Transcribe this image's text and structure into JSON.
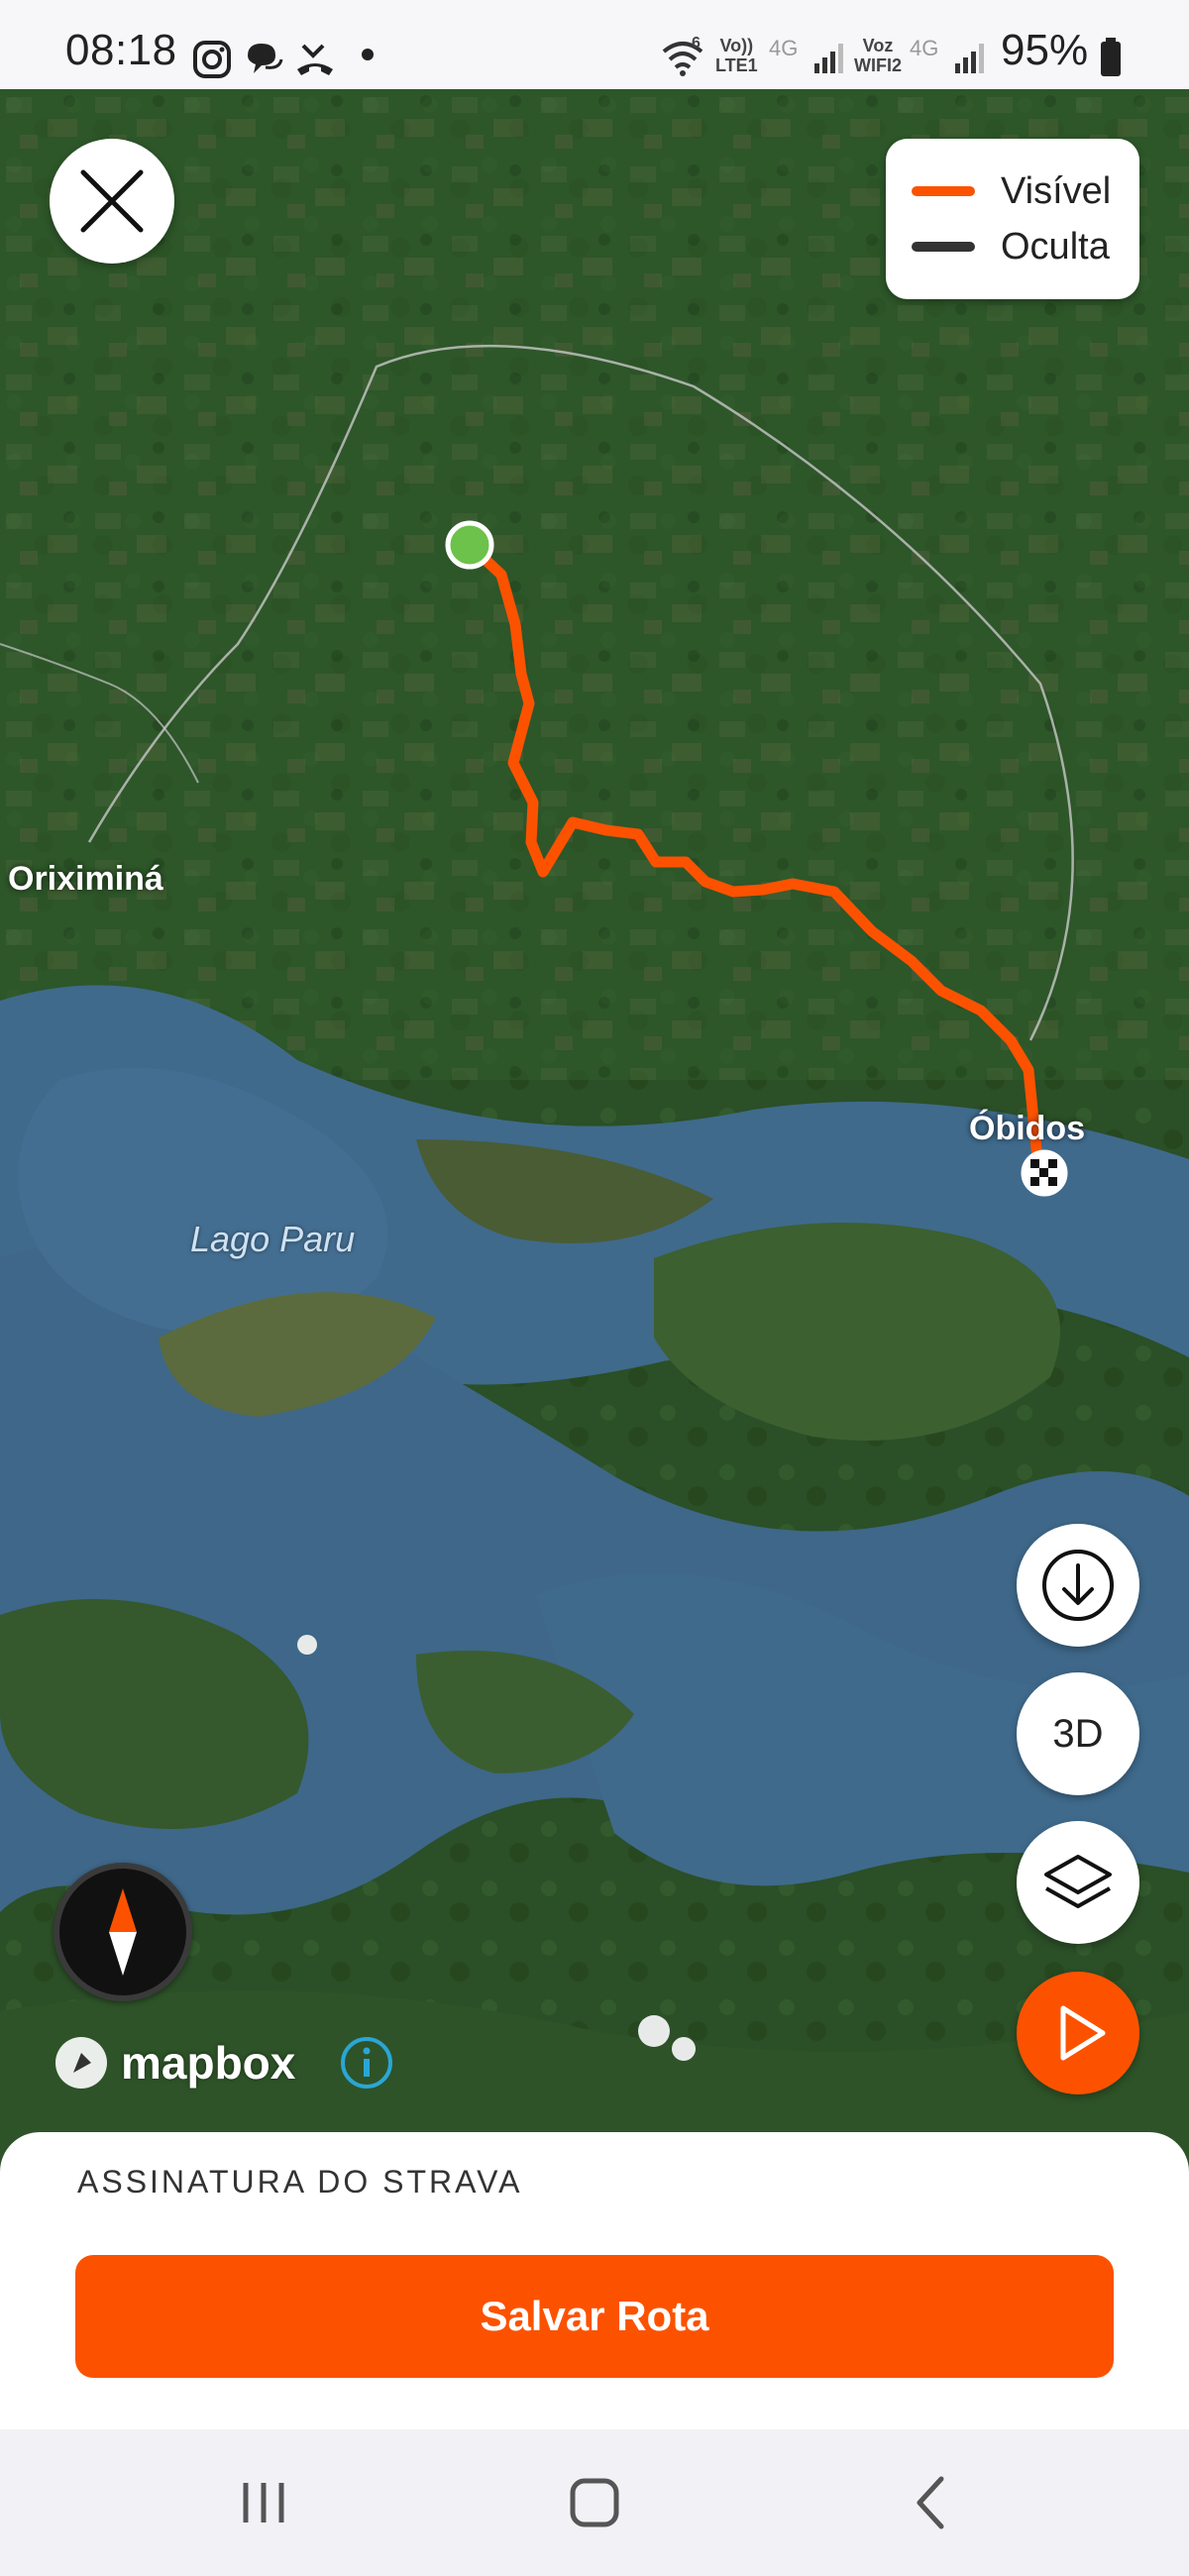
{
  "status_bar": {
    "time": "08:18",
    "battery": "95%",
    "icons": [
      "instagram-icon",
      "chat-icon",
      "missed-call-icon",
      "dot-icon",
      "wifi-icon",
      "signal-icon",
      "battery-icon"
    ],
    "net1": "Vo))\nLTE1",
    "net2": "Voz\nWIFI2",
    "lte_a": "4G",
    "lte_b": "4G",
    "wifi_badge": "6"
  },
  "map": {
    "labels": {
      "oriximina": "Oriximiná",
      "obidos": "Óbidos",
      "lago_paru": "Lago Paru"
    },
    "attribution": "mapbox"
  },
  "legend": {
    "visible_label": "Visível",
    "hidden_label": "Oculta",
    "visible_color": "#fc5200",
    "hidden_color": "#333333"
  },
  "controls": {
    "btn_3d": "3D"
  },
  "sheet": {
    "subtitle": "ASSINATURA DO STRAVA",
    "save_button": "Salvar Rota"
  },
  "colors": {
    "accent": "#fc5200",
    "start_marker": "#6cc24a"
  }
}
